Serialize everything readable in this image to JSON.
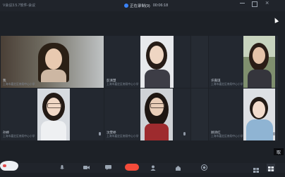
{
  "window": {
    "app_title": "V会议3.5.7软件-会议",
    "recording_label": "正在录制(9)",
    "recording_timer": "00:06:18"
  },
  "participants": [
    {
      "name": "我",
      "sub": "上海市嘉定区南翔中心小学",
      "active": true
    },
    {
      "name": "彭清慧",
      "sub": "上海市嘉定区南翔中心小学",
      "active": false
    },
    {
      "name": "",
      "sub": "",
      "active": false
    },
    {
      "name": "许嘉琪",
      "sub": "上海市嘉定区南翔中心小学",
      "active": false
    },
    {
      "name": "孙婷",
      "sub": "上海市嘉定区南翔中心小学",
      "active": false
    },
    {
      "name": "沈雯婷",
      "sub": "上海市嘉定区南翔中心小学",
      "active": false
    },
    {
      "name": "",
      "sub": "",
      "active": false
    },
    {
      "name": "顾诗红",
      "sub": "上海市嘉定区南翔中心小学",
      "active": false
    }
  ],
  "side_chip": "取",
  "toolbar": {
    "icons": [
      "mic-icon",
      "camera-icon",
      "chat-icon",
      "hangup-icon",
      "participants-icon",
      "share-icon",
      "record-icon",
      "layout-icon",
      "grid-icon"
    ]
  }
}
